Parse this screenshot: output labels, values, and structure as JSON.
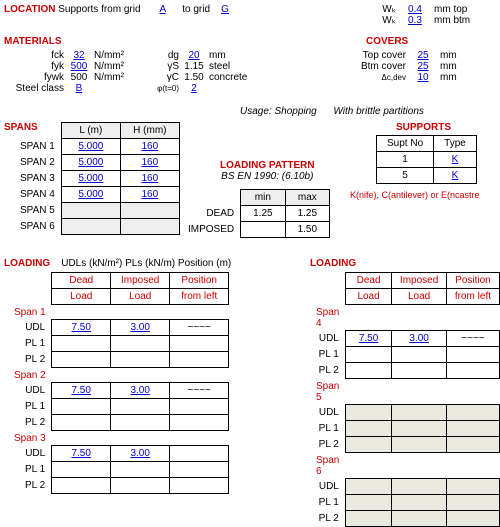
{
  "location": {
    "heading": "LOCATION",
    "text": "Supports from grid",
    "to": "to grid",
    "from": "A",
    "toGrid": "G"
  },
  "wk": {
    "top_sym": "Wₖ",
    "top_val": "0.4",
    "top_unit": "mm top",
    "btm_sym": "Wₖ",
    "btm_val": "0.3",
    "btm_unit": "mm btm"
  },
  "materials": {
    "heading": "MATERIALS",
    "fck": {
      "lab": "fck",
      "val": "32",
      "unit": "N/mm²"
    },
    "fyk": {
      "lab": "fyk",
      "val": "500",
      "unit": "N/mm²"
    },
    "fywk": {
      "lab": "fywk",
      "val": "500",
      "unit": "N/mm²"
    },
    "steel": {
      "lab": "Steel class",
      "val": "B"
    },
    "dg": {
      "lab": "dg",
      "val": "20",
      "unit": "mm"
    },
    "gS": {
      "lab": "γS",
      "val": "1.15",
      "unit": "steel"
    },
    "gC": {
      "lab": "γC",
      "val": "1.50",
      "unit": "concrete"
    },
    "phi": {
      "lab": "φ(t=0)",
      "val": "2"
    }
  },
  "covers": {
    "heading": "COVERS",
    "top": {
      "lab": "Top cover",
      "val": "25",
      "unit": "mm"
    },
    "btm": {
      "lab": "Btm cover",
      "val": "25",
      "unit": "mm"
    },
    "dcdev": {
      "lab": "Δc,dev",
      "val": "10",
      "unit": "mm"
    }
  },
  "usage": {
    "lab": "Usage: Shopping",
    "part": "With brittle partitions"
  },
  "spans": {
    "heading": "SPANS",
    "col1": "L (m)",
    "col2": "H (mm)",
    "rows": [
      {
        "n": "SPAN 1",
        "l": "5.000",
        "h": "160"
      },
      {
        "n": "SPAN 2",
        "l": "5.000",
        "h": "160"
      },
      {
        "n": "SPAN 3",
        "l": "5.000",
        "h": "160"
      },
      {
        "n": "SPAN 4",
        "l": "5.000",
        "h": "160"
      },
      {
        "n": "SPAN 5"
      },
      {
        "n": "SPAN 6"
      }
    ]
  },
  "pattern": {
    "heading": "LOADING PATTERN",
    "note": "BS EN 1990: (6.10b)",
    "min": "min",
    "max": "max",
    "dead": "DEAD",
    "imposed": "IMPOSED",
    "d_min": "1.25",
    "d_max": "1.25",
    "i_max": "1.50"
  },
  "supports": {
    "heading": "SUPPORTS",
    "col1": "Supt No",
    "col2": "Type",
    "r1": {
      "n": "1",
      "t": "K"
    },
    "r2": {
      "n": "5",
      "t": "K"
    },
    "note": "K(nife), C(antilever) or E(ncastre"
  },
  "loading": {
    "heading": "LOADING",
    "sub": "UDLs (kN/m²)  PLs (kN/m)   Position (m)",
    "cols": {
      "dead1": "Dead",
      "dead2": "Load",
      "imp1": "Imposed",
      "imp2": "Load",
      "pos1": "Position",
      "pos2": "from left"
    },
    "labels": {
      "udl": "UDL",
      "pl1": "PL 1",
      "pl2": "PL 2"
    },
    "tilde": "~~~~",
    "left": [
      {
        "name": "Span 1",
        "dead": "7.50",
        "imp": "3.00",
        "pos": "tilde"
      },
      {
        "name": "Span 2",
        "dead": "7.50",
        "imp": "3.00",
        "pos": "tilde"
      },
      {
        "name": "Span 3",
        "dead": "7.50",
        "imp": "3.00"
      }
    ],
    "right": [
      {
        "name": "Span 4",
        "dead": "7.50",
        "imp": "3.00",
        "pos": "tilde"
      },
      {
        "name": "Span 5",
        "empty": true
      },
      {
        "name": "Span 6",
        "empty": true
      }
    ]
  },
  "chart_data": null
}
